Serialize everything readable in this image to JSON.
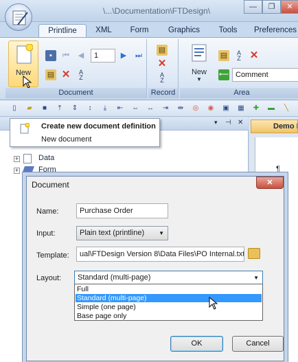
{
  "window": {
    "title": "\\...\\Documentation\\FTDesign\\",
    "minimize": "—",
    "maximize": "❐",
    "close": "✕"
  },
  "ribbon_tabs": [
    "Printline",
    "XML",
    "Form",
    "Graphics",
    "Tools",
    "Preferences"
  ],
  "ribbon": {
    "document_group": {
      "label": "Document",
      "new_label": "New",
      "page_number": "1"
    },
    "record_group": {
      "label": "Record"
    },
    "area_group": {
      "label": "Area",
      "new_label": "New",
      "type_value": "Comment"
    }
  },
  "tooltip": {
    "title": "Create new document definition",
    "subtitle": "New document"
  },
  "panel": {
    "pin_icon": "▾",
    "pushpin": "⊣",
    "close": "✕",
    "tree": [
      {
        "label": "Data",
        "toggle": "+"
      },
      {
        "label": "Form",
        "toggle": "+"
      }
    ]
  },
  "right_tab": {
    "label": "Demo I"
  },
  "dialog": {
    "title": "Document",
    "close": "✕",
    "name_label": "Name:",
    "name_value": "Purchase Order",
    "input_label": "Input:",
    "input_value": "Plain text (printline)",
    "template_label": "Template:",
    "template_value": "ual\\FTDesign Version 8\\Data Files\\PO Internal.txt",
    "layout_label": "Layout:",
    "layout_value": "Standard (multi-page)",
    "layout_options": [
      "Full",
      "Standard (multi-page)",
      "Simple (one page)",
      "Base page only"
    ],
    "layout_selected_index": 1,
    "ok_label": "OK",
    "cancel_label": "Cancel"
  },
  "colors": {
    "accent": "#3399ff",
    "ribbon_blue": "#c7d9ee",
    "cancel_red": "#d83a2a",
    "nav_blue": "#2f6fd0"
  }
}
